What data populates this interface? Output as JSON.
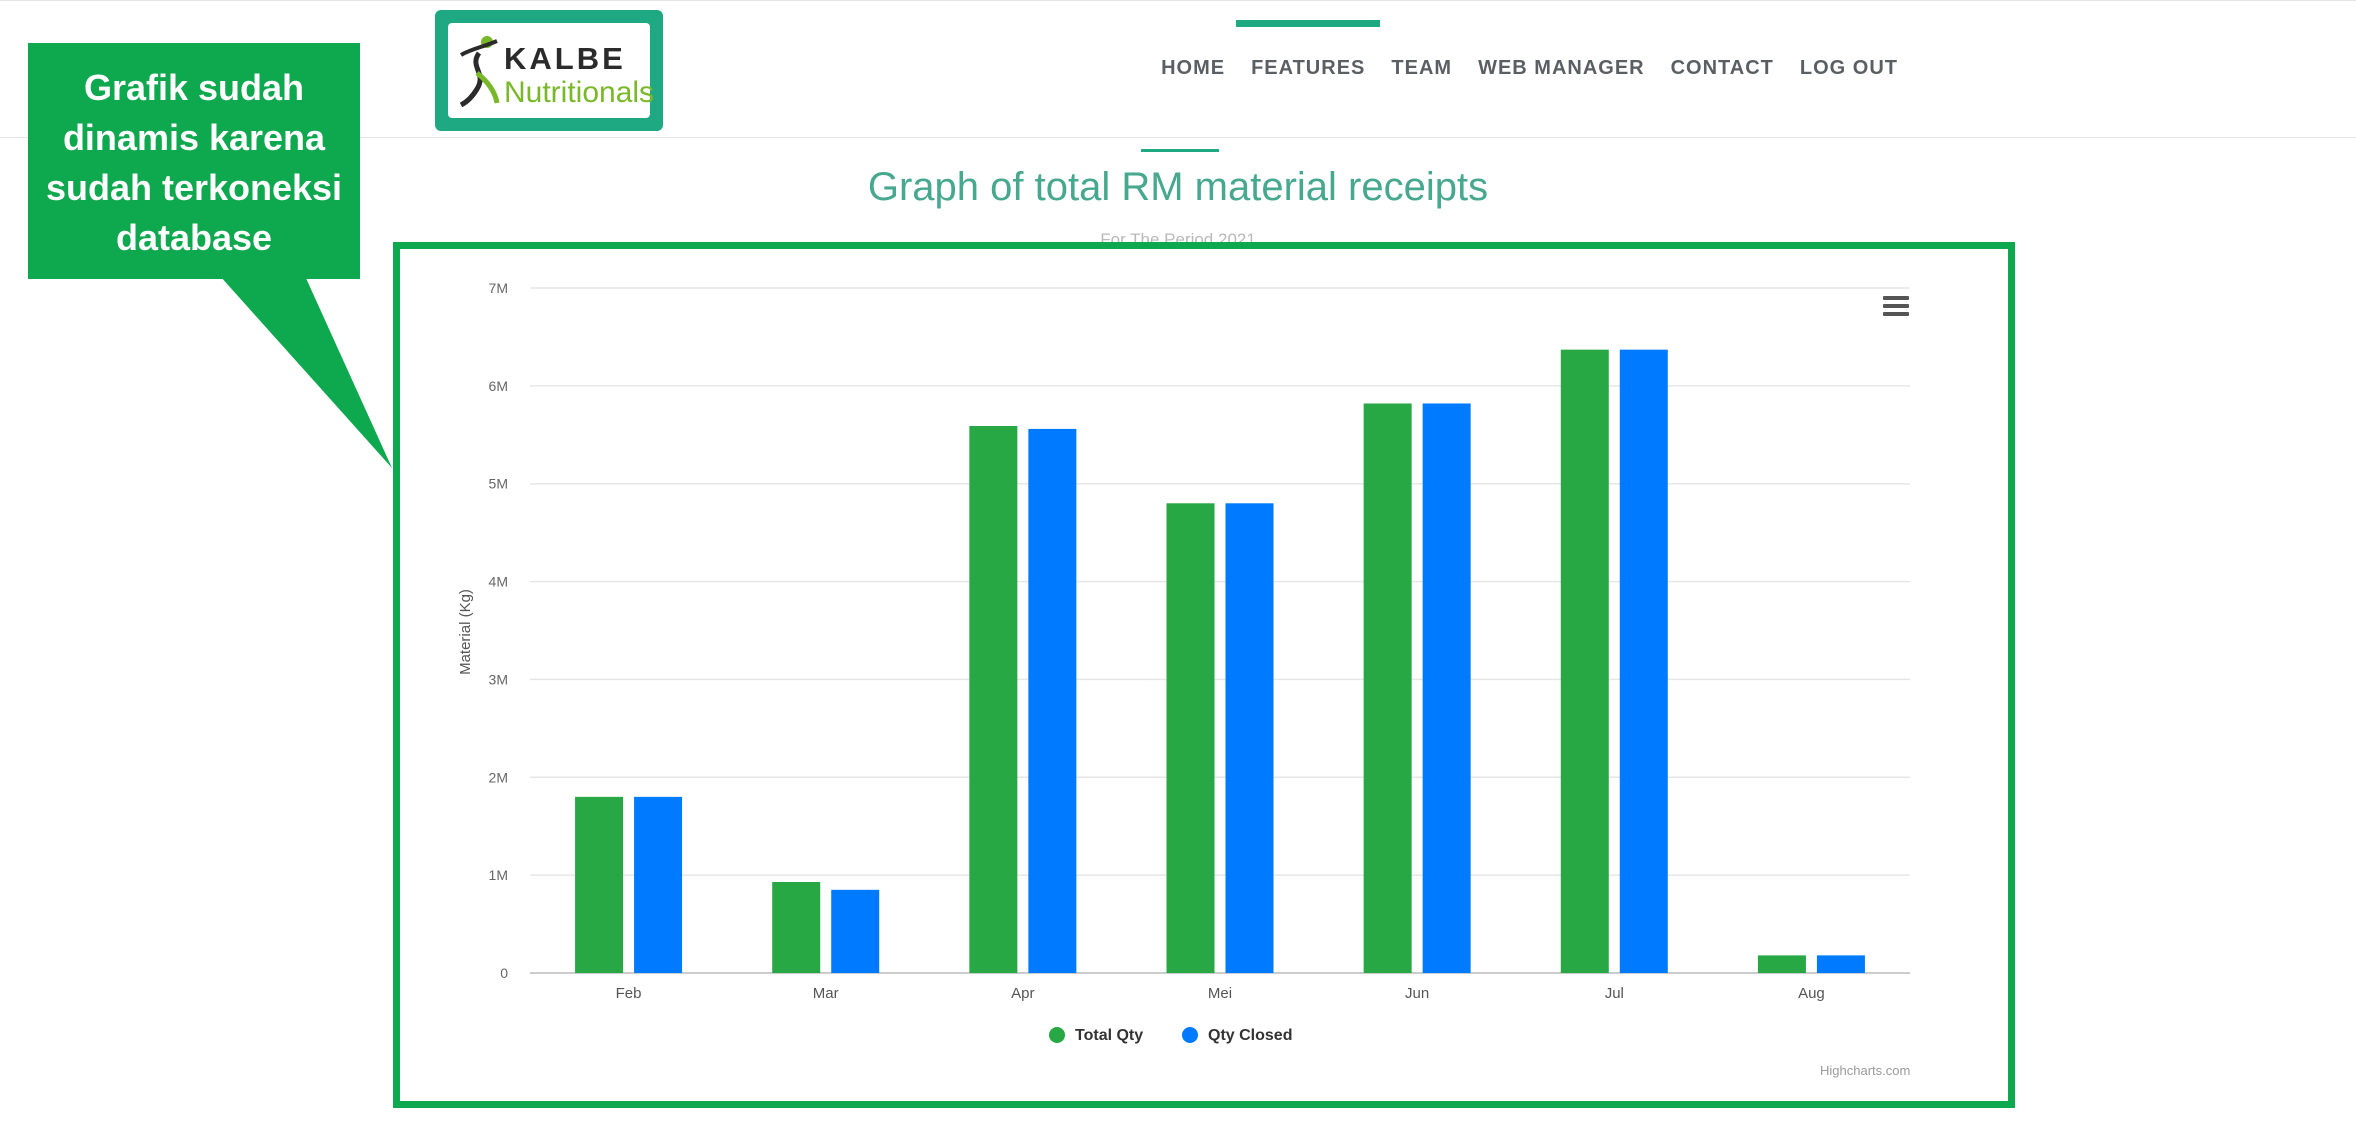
{
  "header": {
    "logo": {
      "brand_top": "KALBE",
      "brand_bottom": "Nutritionals"
    },
    "nav": [
      {
        "label": "HOME",
        "active": false
      },
      {
        "label": "FEATURES",
        "active": true
      },
      {
        "label": "TEAM",
        "active": false
      },
      {
        "label": "WEB MANAGER",
        "active": false
      },
      {
        "label": "CONTACT",
        "active": false
      },
      {
        "label": "LOG OUT",
        "active": false
      }
    ]
  },
  "annotation": {
    "lines": [
      "Grafik sudah",
      "dinamis karena",
      "sudah terkoneksi",
      "database"
    ],
    "color": "#0ea84e"
  },
  "page": {
    "title": "Graph of total RM material receipts",
    "subtitle": "For The Period 2021",
    "accent": "#1fa983"
  },
  "chart": {
    "menu_icon": "hamburger-icon",
    "credits": "Highcharts.com"
  },
  "chart_data": {
    "type": "bar",
    "categories": [
      "Feb",
      "Mar",
      "Apr",
      "Mei",
      "Jun",
      "Jul",
      "Aug"
    ],
    "series": [
      {
        "name": "Total Qty",
        "color": "#28a745",
        "values": [
          1800000,
          930000,
          5590000,
          4800000,
          5820000,
          6370000,
          180000
        ]
      },
      {
        "name": "Qty Closed",
        "color": "#007bff",
        "values": [
          1800000,
          850000,
          5560000,
          4800000,
          5820000,
          6370000,
          180000
        ]
      }
    ],
    "title": "",
    "ylabel": "Material (Kg)",
    "xlabel": "",
    "ylim": [
      0,
      7000000
    ],
    "yticks": [
      0,
      1000000,
      2000000,
      3000000,
      4000000,
      5000000,
      6000000,
      7000000
    ],
    "ytick_labels": [
      "0",
      "1M",
      "2M",
      "3M",
      "4M",
      "5M",
      "6M",
      "7M"
    ],
    "grid": true,
    "legend": "bottom-center"
  }
}
